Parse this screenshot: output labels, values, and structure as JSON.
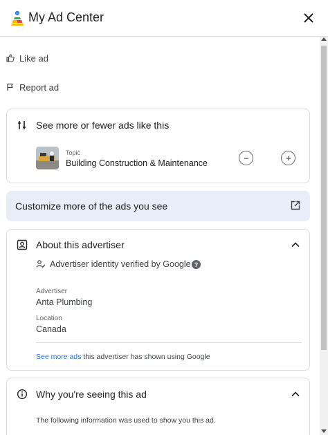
{
  "header": {
    "app_title": "My Ad Center",
    "logo_icon": "my-ad-center-logo",
    "close_icon": "close-icon"
  },
  "actions": {
    "like_label": "Like ad",
    "report_label": "Report ad"
  },
  "more_fewer": {
    "title": "See more or fewer ads like this",
    "topic_label": "Topic",
    "topic_name": "Building Construction & Maintenance"
  },
  "customize": {
    "label": "Customize more of the ads you see"
  },
  "advertiser": {
    "title": "About this advertiser",
    "verified_text": "Advertiser identity verified by Google",
    "help_symbol": "?",
    "advertiser_label": "Advertiser",
    "advertiser_name": "Anta Plumbing",
    "location_label": "Location",
    "location_value": "Canada",
    "see_more_link": "See more ads",
    "see_more_rest": " this advertiser has shown using Google"
  },
  "why": {
    "title": "Why you're seeing this ad",
    "text": "The following information was used to show you this ad."
  },
  "colors": {
    "link": "#1a73e8",
    "customize_bg": "#e8eef7",
    "border": "#dadce0"
  }
}
